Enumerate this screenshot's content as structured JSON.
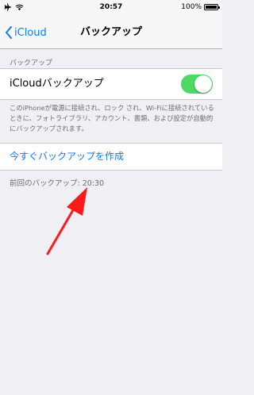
{
  "status_bar": {
    "time": "20:57",
    "battery": "100%"
  },
  "nav": {
    "back_label": "iCloud",
    "title": "バックアップ"
  },
  "section": {
    "header": "バックアップ",
    "toggle_label": "iCloudバックアップ",
    "toggle_on": true,
    "footer": "このiPhoneが電源に接続され、ロック され、Wi-Fiに接続されているときに、フォトライブラリ、アカウント、書類、および設定が自動的にバックアップされます。"
  },
  "action": {
    "backup_now": "今すぐバックアップを作成"
  },
  "last_backup": "前回のバックアップ: 20:30",
  "colors": {
    "accent": "#0a7aff",
    "toggle_on": "#4cd964",
    "arrow": "#ff1a1a"
  },
  "icons": [
    "airplane-icon",
    "wifi-icon",
    "battery-icon",
    "chevron-left-icon"
  ]
}
